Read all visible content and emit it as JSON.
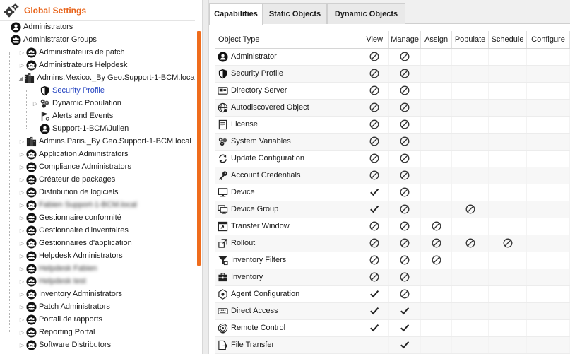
{
  "colors": {
    "accent": "#e8641b",
    "selected_text": "#1f3fbf",
    "scroll_thumb": "#ef6c1c"
  },
  "left": {
    "header": {
      "title": "Global Settings",
      "icon": "gear-icon"
    },
    "tree": [
      {
        "label": "Administrators",
        "icon": "user-icon",
        "level": 0,
        "toggle": ""
      },
      {
        "label": "Administrator Groups",
        "icon": "group-icon",
        "level": 0,
        "toggle": ""
      },
      {
        "label": "Administrateurs de patch",
        "icon": "group-icon",
        "level": 1,
        "toggle": "▷"
      },
      {
        "label": "Administrateurs Helpdesk",
        "icon": "group-icon",
        "level": 1,
        "toggle": "▷"
      },
      {
        "label": "Admins.Mexico._By Geo.Support-1-BCM.local",
        "icon": "org-icon",
        "level": 1,
        "toggle": "◢"
      },
      {
        "label": "Security Profile",
        "icon": "shield-icon",
        "level": 2,
        "toggle": "",
        "selected": true
      },
      {
        "label": "Dynamic Population",
        "icon": "population-icon",
        "level": 2,
        "toggle": "▷"
      },
      {
        "label": "Alerts and Events",
        "icon": "alert-flag-icon",
        "level": 2,
        "toggle": ""
      },
      {
        "label": "Support-1-BCM\\Julien",
        "icon": "user-icon",
        "level": 2,
        "toggle": ""
      },
      {
        "label": "Admins.Paris._By Geo.Support-1-BCM.local",
        "icon": "org-icon",
        "level": 1,
        "toggle": "▷"
      },
      {
        "label": "Application Administrators",
        "icon": "group-icon",
        "level": 1,
        "toggle": "▷"
      },
      {
        "label": "Compliance Administrators",
        "icon": "group-icon",
        "level": 1,
        "toggle": "▷"
      },
      {
        "label": "Créateur de packages",
        "icon": "group-icon",
        "level": 1,
        "toggle": "▷"
      },
      {
        "label": "Distribution de logiciels",
        "icon": "group-icon",
        "level": 1,
        "toggle": "▷"
      },
      {
        "label": "Fabien Support-1-BCM.local",
        "icon": "group-icon",
        "level": 1,
        "toggle": "▷",
        "blurred": true
      },
      {
        "label": "Gestionnaire conformité",
        "icon": "group-icon",
        "level": 1,
        "toggle": "▷"
      },
      {
        "label": "Gestionnaire d'inventaires",
        "icon": "group-icon",
        "level": 1,
        "toggle": "▷"
      },
      {
        "label": "Gestionnaires d'application",
        "icon": "group-icon",
        "level": 1,
        "toggle": "▷"
      },
      {
        "label": "Helpdesk Administrators",
        "icon": "group-icon",
        "level": 1,
        "toggle": "▷"
      },
      {
        "label": "Helpdesk Fabien",
        "icon": "group-icon",
        "level": 1,
        "toggle": "▷",
        "blurred": true
      },
      {
        "label": "Helpdesk test",
        "icon": "group-icon",
        "level": 1,
        "toggle": "▷",
        "blurred": true
      },
      {
        "label": "Inventory Administrators",
        "icon": "group-icon",
        "level": 1,
        "toggle": "▷"
      },
      {
        "label": "Patch Administrators",
        "icon": "group-icon",
        "level": 1,
        "toggle": "▷"
      },
      {
        "label": "Portail de rapports",
        "icon": "group-icon",
        "level": 1,
        "toggle": "▷"
      },
      {
        "label": "Reporting Portal",
        "icon": "group-icon",
        "level": 1,
        "toggle": "▷"
      },
      {
        "label": "Software Distributors",
        "icon": "group-icon",
        "level": 1,
        "toggle": "▷"
      }
    ]
  },
  "right": {
    "tabs": [
      {
        "label": "Capabilities",
        "active": true
      },
      {
        "label": "Static Objects",
        "active": false
      },
      {
        "label": "Dynamic Objects",
        "active": false
      }
    ],
    "columns": [
      "Object Type",
      "View",
      "Manage",
      "Assign",
      "Populate",
      "Schedule",
      "Configure"
    ],
    "rows": [
      {
        "label": "Administrator",
        "icon": "user-icon",
        "caps": [
          "no",
          "no",
          "",
          "",
          "",
          ""
        ]
      },
      {
        "label": "Security Profile",
        "icon": "shield-icon",
        "caps": [
          "no",
          "no",
          "",
          "",
          "",
          ""
        ]
      },
      {
        "label": "Directory Server",
        "icon": "directory-server-icon",
        "caps": [
          "no",
          "no",
          "",
          "",
          "",
          ""
        ]
      },
      {
        "label": "Autodiscovered Object",
        "icon": "globe-icon",
        "caps": [
          "no",
          "no",
          "",
          "",
          "",
          ""
        ]
      },
      {
        "label": "License",
        "icon": "license-icon",
        "caps": [
          "no",
          "no",
          "",
          "",
          "",
          ""
        ]
      },
      {
        "label": "System Variables",
        "icon": "variables-icon",
        "caps": [
          "no",
          "no",
          "",
          "",
          "",
          ""
        ]
      },
      {
        "label": "Update Configuration",
        "icon": "update-icon",
        "caps": [
          "no",
          "no",
          "",
          "",
          "",
          ""
        ]
      },
      {
        "label": "Account Credentials",
        "icon": "key-icon",
        "caps": [
          "no",
          "no",
          "",
          "",
          "",
          ""
        ]
      },
      {
        "label": "Device",
        "icon": "monitor-icon",
        "caps": [
          "yes",
          "no",
          "",
          "",
          "",
          ""
        ]
      },
      {
        "label": "Device Group",
        "icon": "device-group-icon",
        "caps": [
          "yes",
          "no",
          "",
          "no",
          "",
          ""
        ]
      },
      {
        "label": "Transfer Window",
        "icon": "transfer-window-icon",
        "caps": [
          "no",
          "no",
          "no",
          "",
          "",
          ""
        ]
      },
      {
        "label": "Rollout",
        "icon": "rollout-icon",
        "caps": [
          "no",
          "no",
          "no",
          "no",
          "no",
          ""
        ]
      },
      {
        "label": "Inventory Filters",
        "icon": "filter-icon",
        "caps": [
          "no",
          "no",
          "no",
          "",
          "",
          ""
        ]
      },
      {
        "label": "Inventory",
        "icon": "inventory-icon",
        "caps": [
          "no",
          "no",
          "",
          "",
          "",
          ""
        ]
      },
      {
        "label": "Agent Configuration",
        "icon": "agent-icon",
        "caps": [
          "yes",
          "no",
          "",
          "",
          "",
          ""
        ]
      },
      {
        "label": "Direct Access",
        "icon": "keyboard-icon",
        "caps": [
          "yes",
          "yes",
          "",
          "",
          "",
          ""
        ]
      },
      {
        "label": "Remote Control",
        "icon": "remote-control-icon",
        "caps": [
          "yes",
          "yes",
          "",
          "",
          "",
          ""
        ]
      },
      {
        "label": "File Transfer",
        "icon": "file-transfer-icon",
        "caps": [
          "",
          "yes",
          "",
          "",
          "",
          ""
        ]
      }
    ]
  }
}
